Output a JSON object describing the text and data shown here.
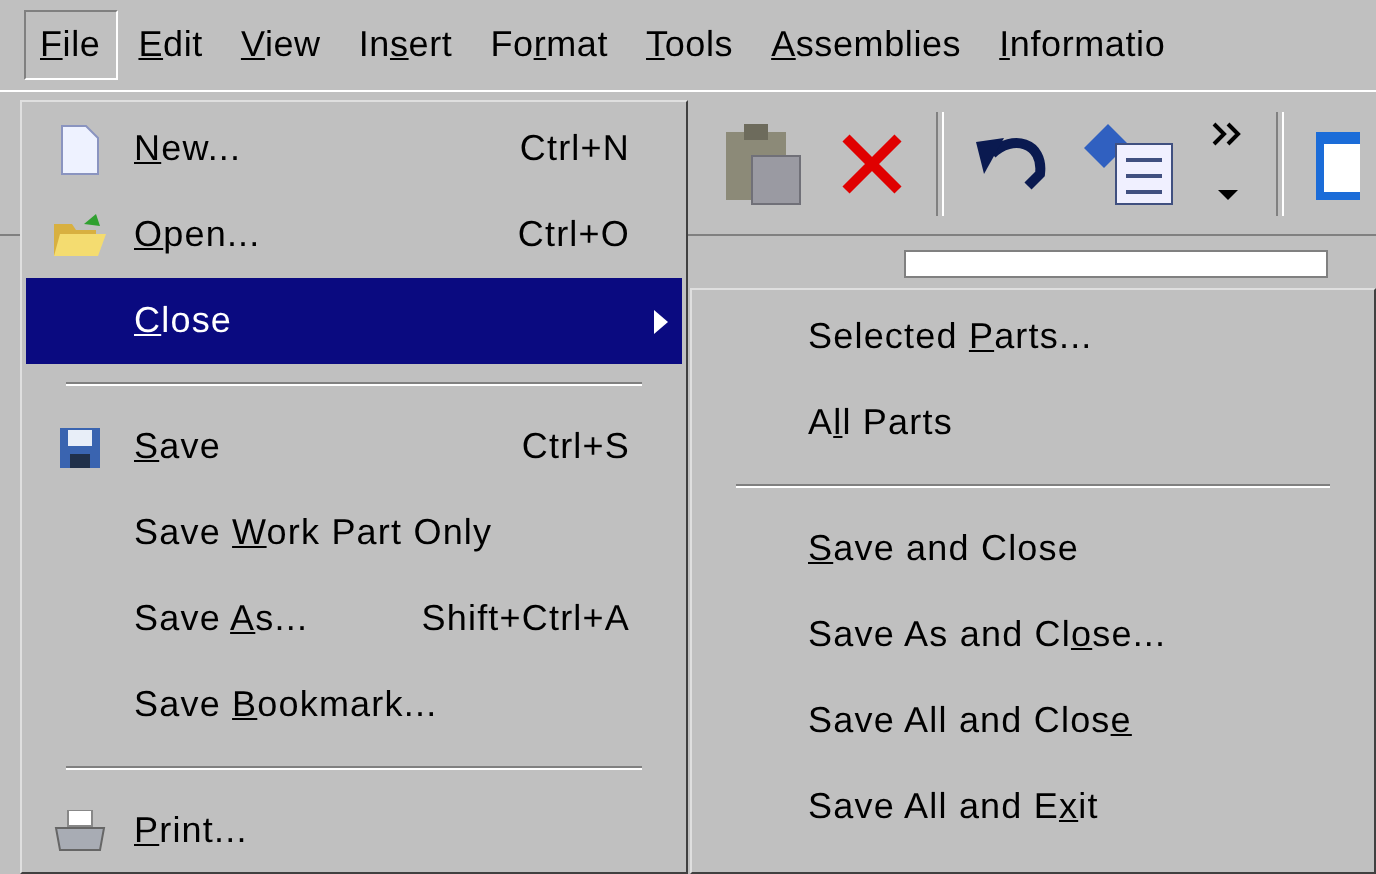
{
  "menubar": [
    {
      "label": [
        {
          "text": "F",
          "underlined": true
        },
        {
          "text": "ile",
          "underlined": false
        }
      ],
      "selected": true
    },
    {
      "label": [
        {
          "text": "E",
          "underlined": true
        },
        {
          "text": "dit",
          "underlined": false
        }
      ],
      "selected": false
    },
    {
      "label": [
        {
          "text": "V",
          "underlined": true
        },
        {
          "text": "iew",
          "underlined": false
        }
      ],
      "selected": false
    },
    {
      "label": [
        {
          "text": "In",
          "underlined": false
        },
        {
          "text": "s",
          "underlined": true
        },
        {
          "text": "ert",
          "underlined": false
        }
      ],
      "selected": false
    },
    {
      "label": [
        {
          "text": "Fo",
          "underlined": false
        },
        {
          "text": "r",
          "underlined": true
        },
        {
          "text": "mat",
          "underlined": false
        }
      ],
      "selected": false
    },
    {
      "label": [
        {
          "text": "T",
          "underlined": true
        },
        {
          "text": "ools",
          "underlined": false
        }
      ],
      "selected": false
    },
    {
      "label": [
        {
          "text": "A",
          "underlined": true
        },
        {
          "text": "ssemblies",
          "underlined": false
        }
      ],
      "selected": false
    },
    {
      "label": [
        {
          "text": "I",
          "underlined": true
        },
        {
          "text": "nformatio",
          "underlined": false
        }
      ],
      "selected": false
    }
  ],
  "file_menu": [
    {
      "kind": "item",
      "label": [
        {
          "text": "N",
          "underlined": true
        },
        {
          "text": "ew...",
          "underlined": false
        }
      ],
      "shortcut": "Ctrl+N",
      "selected": false
    },
    {
      "kind": "item",
      "label": [
        {
          "text": "O",
          "underlined": true
        },
        {
          "text": "pen...",
          "underlined": false
        }
      ],
      "shortcut": "Ctrl+O",
      "selected": false
    },
    {
      "kind": "submenu",
      "label": [
        {
          "text": "C",
          "underlined": true
        },
        {
          "text": "lose",
          "underlined": false
        }
      ],
      "selected": true
    },
    {
      "kind": "separator"
    },
    {
      "kind": "item",
      "label": [
        {
          "text": "S",
          "underlined": true
        },
        {
          "text": "ave",
          "underlined": false
        }
      ],
      "shortcut": "Ctrl+S",
      "selected": false
    },
    {
      "kind": "item",
      "label": [
        {
          "text": "Save ",
          "underlined": false
        },
        {
          "text": "W",
          "underlined": true
        },
        {
          "text": "ork Part Only",
          "underlined": false
        }
      ],
      "selected": false
    },
    {
      "kind": "item",
      "label": [
        {
          "text": "Save ",
          "underlined": false
        },
        {
          "text": "A",
          "underlined": true
        },
        {
          "text": "s...",
          "underlined": false
        }
      ],
      "shortcut": "Shift+Ctrl+A",
      "selected": false
    },
    {
      "kind": "item",
      "label": [
        {
          "text": "Save ",
          "underlined": false
        },
        {
          "text": "B",
          "underlined": true
        },
        {
          "text": "ookmark...",
          "underlined": false
        }
      ],
      "selected": false
    },
    {
      "kind": "separator"
    },
    {
      "kind": "item",
      "label": [
        {
          "text": "P",
          "underlined": true
        },
        {
          "text": "rint...",
          "underlined": false
        }
      ],
      "selected": false
    }
  ],
  "close_submenu": [
    {
      "kind": "item",
      "label": [
        {
          "text": "Selected ",
          "underlined": false
        },
        {
          "text": "P",
          "underlined": true
        },
        {
          "text": "arts...",
          "underlined": false
        }
      ],
      "selected": false
    },
    {
      "kind": "item",
      "label": [
        {
          "text": "A",
          "underlined": false
        },
        {
          "text": "l",
          "underlined": true
        },
        {
          "text": "l Parts",
          "underlined": false
        }
      ],
      "selected": false
    },
    {
      "kind": "separator"
    },
    {
      "kind": "item",
      "label": [
        {
          "text": "S",
          "underlined": true
        },
        {
          "text": "ave and Close",
          "underlined": false
        }
      ],
      "selected": false
    },
    {
      "kind": "item",
      "label": [
        {
          "text": "Save As and Cl",
          "underlined": false
        },
        {
          "text": "o",
          "underlined": true
        },
        {
          "text": "se...",
          "underlined": false
        }
      ],
      "selected": false
    },
    {
      "kind": "item",
      "label": [
        {
          "text": "Save All and Clos",
          "underlined": false
        },
        {
          "text": "e",
          "underlined": true
        }
      ],
      "selected": false
    },
    {
      "kind": "item",
      "label": [
        {
          "text": "Save All and E",
          "underlined": false
        },
        {
          "text": "x",
          "underlined": true
        },
        {
          "text": "it",
          "underlined": false
        }
      ],
      "selected": false
    }
  ]
}
